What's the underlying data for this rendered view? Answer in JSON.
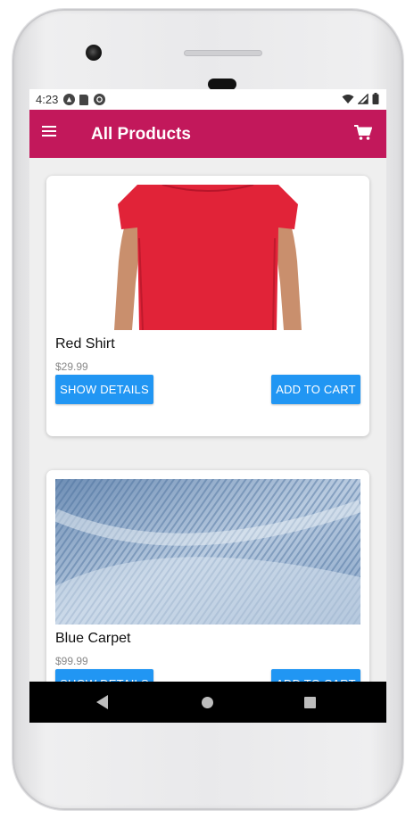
{
  "status_bar": {
    "time": "4:23",
    "icons_left": [
      "android-icon",
      "sd-card-icon",
      "sync-icon"
    ],
    "icons_right": [
      "wifi-icon",
      "signal-icon",
      "battery-icon"
    ]
  },
  "app_bar": {
    "title": "All Products",
    "background": "#c2185b",
    "menu_icon": "menu-icon",
    "cart_icon": "shopping-cart-icon"
  },
  "products": [
    {
      "title": "Red Shirt",
      "price": "$29.99",
      "show_details_label": "SHOW DETAILS",
      "add_to_cart_label": "ADD TO CART"
    },
    {
      "title": "Blue Carpet",
      "price": "$99.99",
      "show_details_label": "SHOW DETAILS",
      "add_to_cart_label": "ADD TO CART"
    }
  ],
  "colors": {
    "accent": "#2196f3",
    "primary": "#c2185b"
  },
  "nav_bar": {
    "icons": [
      "back-icon",
      "home-icon",
      "recent-apps-icon"
    ]
  }
}
